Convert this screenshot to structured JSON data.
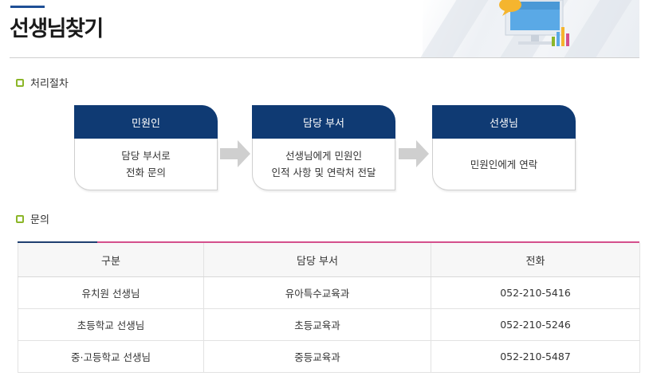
{
  "page": {
    "title": "선생님찾기"
  },
  "process": {
    "heading": "처리절차",
    "steps": [
      {
        "title": "민원인",
        "body": "담당 부서로\n전화 문의"
      },
      {
        "title": "담당 부서",
        "body": "선생님에게 민원인\n인적 사항 및 연락처 전달"
      },
      {
        "title": "선생님",
        "body": "민원인에게 연락"
      }
    ]
  },
  "inquiry": {
    "heading": "문의",
    "columns": [
      "구분",
      "담당 부서",
      "전화"
    ],
    "rows": [
      [
        "유치원 선생님",
        "유아특수교육과",
        "052-210-5416"
      ],
      [
        "초등학교 선생님",
        "초등교육과",
        "052-210-5246"
      ],
      [
        "중·고등학교 선생님",
        "중등교육과",
        "052-210-5487"
      ]
    ]
  },
  "colors": {
    "step_header": "#0f3a73",
    "bullet": "#8cb629",
    "table_top_accent": "#d44f8c",
    "title_accent": "#1f4f96"
  },
  "icons": {
    "header_illustration": "computer-monitor-chart-icon",
    "section_bullet": "square-bullet-icon",
    "step_arrow": "right-arrow-icon"
  }
}
